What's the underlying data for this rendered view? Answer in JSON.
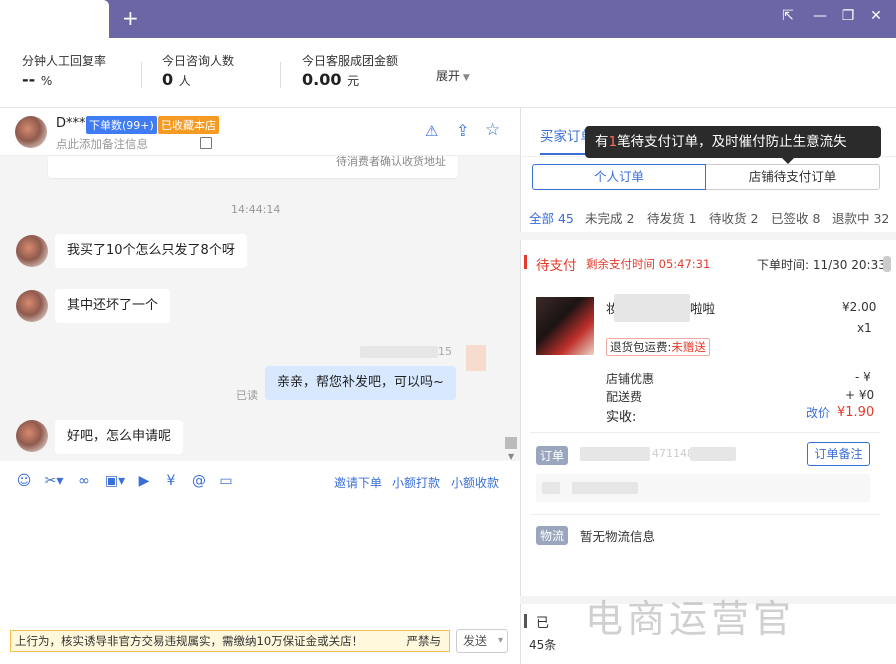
{
  "window": {
    "add_tab": "+",
    "pin_icon": "⇱",
    "minimize": "—",
    "restore": "❐",
    "close": "✕"
  },
  "stats": {
    "s1_label": "分钟人工回复率",
    "s1_value": "--",
    "s1_unit": "%",
    "s2_label": "今日咨询人数",
    "s2_value": "0",
    "s2_unit": "人",
    "s3_label": "今日客服成团金额",
    "s3_value": "0.00",
    "s3_unit": "元",
    "expand": "展开"
  },
  "chat_header": {
    "name": "D***",
    "order_tag": "下单数(99+)",
    "fav_tag": "已收藏本店",
    "note_placeholder": "点此添加备注信息"
  },
  "chat": {
    "partial_msg": "待消费者确认收货地址",
    "time": "14:44:14",
    "m1": "我买了10个怎么只发了8个呀",
    "m2": "其中还坏了一个",
    "agent_meta": "15",
    "m3": "亲亲，帮您补发吧，可以吗~",
    "read": "已读",
    "m4": "好吧，怎么申请呢"
  },
  "toolbar": {
    "invite_order": "邀请下单",
    "small_pay": "小额打款",
    "small_collect": "小额收款"
  },
  "warning": {
    "text": "上行为，核实诱导非官方交易违规属实，需缴纳10万保证金或关店！",
    "strict": "严禁与"
  },
  "send": {
    "label": "发送",
    "arrow": "▾"
  },
  "right": {
    "tab_buyer_orders": "买家订单",
    "tooltip_pre": "有",
    "tooltip_count": "1",
    "tooltip_post": "笔待支付订单，及时催付防止生意流失",
    "seg_personal": "个人订单",
    "seg_store_pending": "店铺待支付订单",
    "filters": [
      "全部 45",
      "未完成 2",
      "待发货 1",
      "待收货 2",
      "已签收 8",
      "退款中 32"
    ],
    "order": {
      "status": "待支付",
      "remaining_label": "剩余支付时间",
      "remaining_time": "05:47:31",
      "order_time": "下单时间: 11/30 20:33",
      "title_start": "妆",
      "title_end": "啦啦",
      "price": "¥2.00",
      "qty": "x1",
      "shipping_ins_label": "退货包运费:",
      "shipping_ins_value": "未赠送",
      "discount_label": "店铺优惠",
      "discount_value": "- ¥",
      "delivery_label": "配送费",
      "delivery_value": "+ ¥0",
      "paid_label": "实收:",
      "modify_price": "改价",
      "paid_value": "¥1.90",
      "order_tag": "订单",
      "order_no_fragment": "471148",
      "remark_btn": "订单备注",
      "logistics_tag": "物流",
      "logistics_text": "暂无物流信息"
    },
    "bottom_partial_1": "已",
    "bottom_partial_2": "45条"
  },
  "watermark": "电商运营官"
}
